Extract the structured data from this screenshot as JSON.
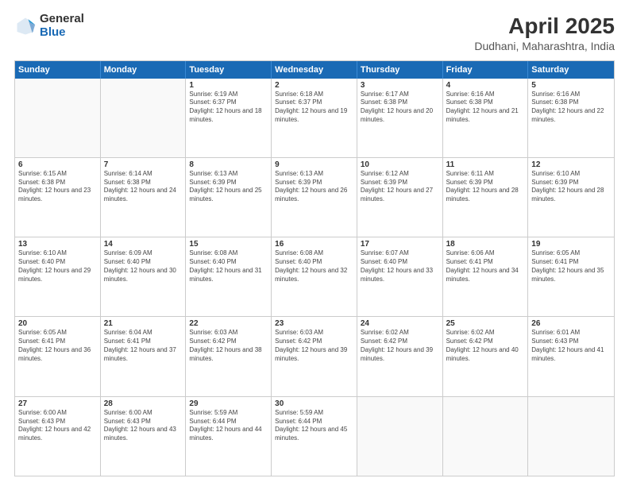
{
  "logo": {
    "general": "General",
    "blue": "Blue"
  },
  "title": "April 2025",
  "subtitle": "Dudhani, Maharashtra, India",
  "headers": [
    "Sunday",
    "Monday",
    "Tuesday",
    "Wednesday",
    "Thursday",
    "Friday",
    "Saturday"
  ],
  "rows": [
    [
      {
        "day": "",
        "info": ""
      },
      {
        "day": "",
        "info": ""
      },
      {
        "day": "1",
        "info": "Sunrise: 6:19 AM\nSunset: 6:37 PM\nDaylight: 12 hours and 18 minutes."
      },
      {
        "day": "2",
        "info": "Sunrise: 6:18 AM\nSunset: 6:37 PM\nDaylight: 12 hours and 19 minutes."
      },
      {
        "day": "3",
        "info": "Sunrise: 6:17 AM\nSunset: 6:38 PM\nDaylight: 12 hours and 20 minutes."
      },
      {
        "day": "4",
        "info": "Sunrise: 6:16 AM\nSunset: 6:38 PM\nDaylight: 12 hours and 21 minutes."
      },
      {
        "day": "5",
        "info": "Sunrise: 6:16 AM\nSunset: 6:38 PM\nDaylight: 12 hours and 22 minutes."
      }
    ],
    [
      {
        "day": "6",
        "info": "Sunrise: 6:15 AM\nSunset: 6:38 PM\nDaylight: 12 hours and 23 minutes."
      },
      {
        "day": "7",
        "info": "Sunrise: 6:14 AM\nSunset: 6:38 PM\nDaylight: 12 hours and 24 minutes."
      },
      {
        "day": "8",
        "info": "Sunrise: 6:13 AM\nSunset: 6:39 PM\nDaylight: 12 hours and 25 minutes."
      },
      {
        "day": "9",
        "info": "Sunrise: 6:13 AM\nSunset: 6:39 PM\nDaylight: 12 hours and 26 minutes."
      },
      {
        "day": "10",
        "info": "Sunrise: 6:12 AM\nSunset: 6:39 PM\nDaylight: 12 hours and 27 minutes."
      },
      {
        "day": "11",
        "info": "Sunrise: 6:11 AM\nSunset: 6:39 PM\nDaylight: 12 hours and 28 minutes."
      },
      {
        "day": "12",
        "info": "Sunrise: 6:10 AM\nSunset: 6:39 PM\nDaylight: 12 hours and 28 minutes."
      }
    ],
    [
      {
        "day": "13",
        "info": "Sunrise: 6:10 AM\nSunset: 6:40 PM\nDaylight: 12 hours and 29 minutes."
      },
      {
        "day": "14",
        "info": "Sunrise: 6:09 AM\nSunset: 6:40 PM\nDaylight: 12 hours and 30 minutes."
      },
      {
        "day": "15",
        "info": "Sunrise: 6:08 AM\nSunset: 6:40 PM\nDaylight: 12 hours and 31 minutes."
      },
      {
        "day": "16",
        "info": "Sunrise: 6:08 AM\nSunset: 6:40 PM\nDaylight: 12 hours and 32 minutes."
      },
      {
        "day": "17",
        "info": "Sunrise: 6:07 AM\nSunset: 6:40 PM\nDaylight: 12 hours and 33 minutes."
      },
      {
        "day": "18",
        "info": "Sunrise: 6:06 AM\nSunset: 6:41 PM\nDaylight: 12 hours and 34 minutes."
      },
      {
        "day": "19",
        "info": "Sunrise: 6:05 AM\nSunset: 6:41 PM\nDaylight: 12 hours and 35 minutes."
      }
    ],
    [
      {
        "day": "20",
        "info": "Sunrise: 6:05 AM\nSunset: 6:41 PM\nDaylight: 12 hours and 36 minutes."
      },
      {
        "day": "21",
        "info": "Sunrise: 6:04 AM\nSunset: 6:41 PM\nDaylight: 12 hours and 37 minutes."
      },
      {
        "day": "22",
        "info": "Sunrise: 6:03 AM\nSunset: 6:42 PM\nDaylight: 12 hours and 38 minutes."
      },
      {
        "day": "23",
        "info": "Sunrise: 6:03 AM\nSunset: 6:42 PM\nDaylight: 12 hours and 39 minutes."
      },
      {
        "day": "24",
        "info": "Sunrise: 6:02 AM\nSunset: 6:42 PM\nDaylight: 12 hours and 39 minutes."
      },
      {
        "day": "25",
        "info": "Sunrise: 6:02 AM\nSunset: 6:42 PM\nDaylight: 12 hours and 40 minutes."
      },
      {
        "day": "26",
        "info": "Sunrise: 6:01 AM\nSunset: 6:43 PM\nDaylight: 12 hours and 41 minutes."
      }
    ],
    [
      {
        "day": "27",
        "info": "Sunrise: 6:00 AM\nSunset: 6:43 PM\nDaylight: 12 hours and 42 minutes."
      },
      {
        "day": "28",
        "info": "Sunrise: 6:00 AM\nSunset: 6:43 PM\nDaylight: 12 hours and 43 minutes."
      },
      {
        "day": "29",
        "info": "Sunrise: 5:59 AM\nSunset: 6:44 PM\nDaylight: 12 hours and 44 minutes."
      },
      {
        "day": "30",
        "info": "Sunrise: 5:59 AM\nSunset: 6:44 PM\nDaylight: 12 hours and 45 minutes."
      },
      {
        "day": "",
        "info": ""
      },
      {
        "day": "",
        "info": ""
      },
      {
        "day": "",
        "info": ""
      }
    ]
  ]
}
